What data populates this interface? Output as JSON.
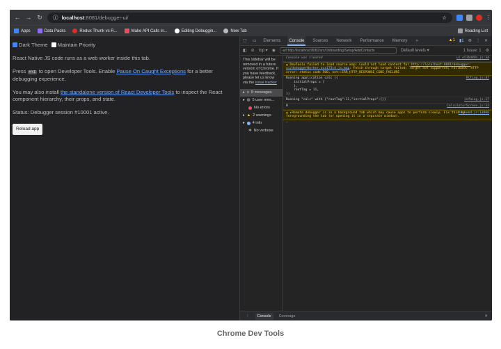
{
  "browser": {
    "url_host": "localhost",
    "url_rest": ":8081/debugger-ui/",
    "bookmarks": [
      {
        "label": "Apps",
        "color": "#4285f4"
      },
      {
        "label": "Data Packs",
        "color": "#8e6cf0"
      },
      {
        "label": "Redux Thunk vs R...",
        "color": "#d93025"
      },
      {
        "label": "Make API Calls in...",
        "color": "#e8505b"
      },
      {
        "label": "Editing Debuggin...",
        "color": "#ffffff"
      },
      {
        "label": "New Tab",
        "color": "#bbbbbb"
      }
    ],
    "reading_list": "Reading List"
  },
  "app": {
    "dark_theme": "Dark Theme",
    "maintain_priority": "Maintain Priority",
    "intro": "React Native JS code runs as a web worker inside this tab.",
    "press": "Press",
    "shortcut": "⌘⌥I",
    "open_tools": "to open Developer Tools. Enable",
    "pause_link": "Pause On Caught Exceptions",
    "better": "for a better debugging experience.",
    "install_pre": "You may also install",
    "standalone_link": "the standalone version of React Developer Tools",
    "install_post": "to inspect the React component hierarchy, their props, and state.",
    "status": "Status: Debugger session #10001 active.",
    "reload_label": "Reload app"
  },
  "devtools": {
    "tabs": [
      "Elements",
      "Console",
      "Sources",
      "Network",
      "Performance",
      "Memory",
      "»"
    ],
    "active_tab": "Console",
    "top_context": "top ▾",
    "filter_value": "-url:http://localhost:8081/src/Onboarding/Setup/AddContacts",
    "default_levels": "Default levels ▾",
    "issues": "1 Issue: 1",
    "sidebar_note_pre": "This sidebar will be removed in a future version of Chrome. If you have feedback, please let us know via the",
    "sidebar_note_link": "issue tracker",
    "sidebar_items": [
      {
        "label": "8 messages",
        "color": "#9aa0a6"
      },
      {
        "label": "5 user mes...",
        "color": "#9aa0a6"
      },
      {
        "label": "No errors",
        "color": "#e8505b"
      },
      {
        "label": "2 warnings",
        "color": "#f2c94c"
      },
      {
        "label": "4 info",
        "color": "#8ab4f8"
      },
      {
        "label": "No verbose",
        "color": "#9aa0a6"
      }
    ],
    "console": {
      "cleared": "Console was cleared",
      "cleared_src": "ui.e53bd40a.js:34",
      "warn1_pre": "DevTools failed to load source map: Could not load content for",
      "warn1_link": "http://localhost:8081/debugger-ui/debuggerWorker.aca173c4.js.map",
      "warn1_post": ": Fetch through target failed: Target not supported; Fallback: HTTP error: status code 500, net::ERR_HTTP_RESPONSE_CODE_FAILURE",
      "log1": "Running application calc ({\n    initialProps = {\n    },\n    rootTag = 11,\n})",
      "log1_src": "RCTLog.js:47",
      "log2": "Running \"calc\" with {\"rootTag\":11,\"initialProps\":{}}",
      "log2_src": "infoLog.js:17",
      "log3": "0",
      "log3_src": "CalculatorScreen.js:33",
      "warn2": "▸Remote debugger is in a background tab which may cause apps to perform slowly. Fix this by foregrounding the tab (or opening it in a separate window).",
      "warn2_src": "backend.js:13866"
    },
    "drawer_tabs": [
      "Console",
      "Coverage"
    ]
  },
  "caption": "Chrome Dev Tools"
}
